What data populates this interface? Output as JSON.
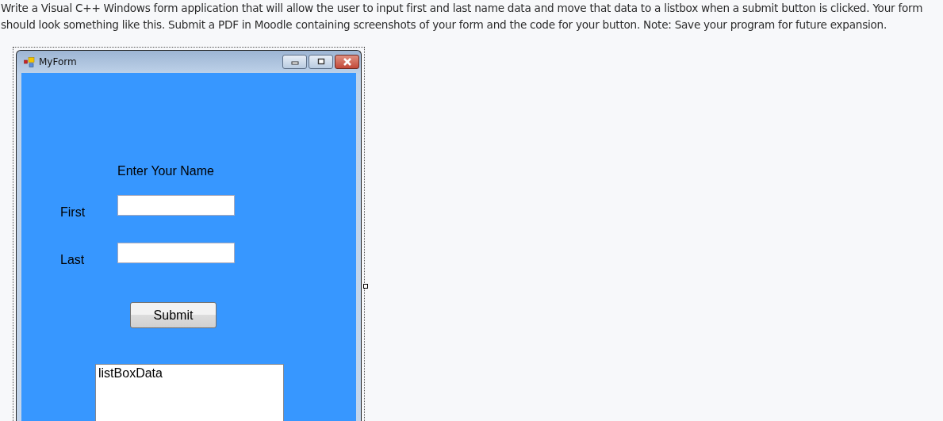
{
  "instructions": "Write a Visual C++ Windows form application that will allow the user to input first and last name data and move that data to a listbox when a submit button is clicked.  Your form should look something like this.  Submit a PDF in Moodle containing screenshots of your form and the code for your button.  Note:  Save your program for future expansion.",
  "window": {
    "title": "MyForm"
  },
  "form": {
    "heading": "Enter Your Name",
    "fields": [
      {
        "label": "First"
      },
      {
        "label": "Last"
      }
    ],
    "button": "Submit",
    "listbox": {
      "items": [
        "listBoxData"
      ]
    }
  }
}
